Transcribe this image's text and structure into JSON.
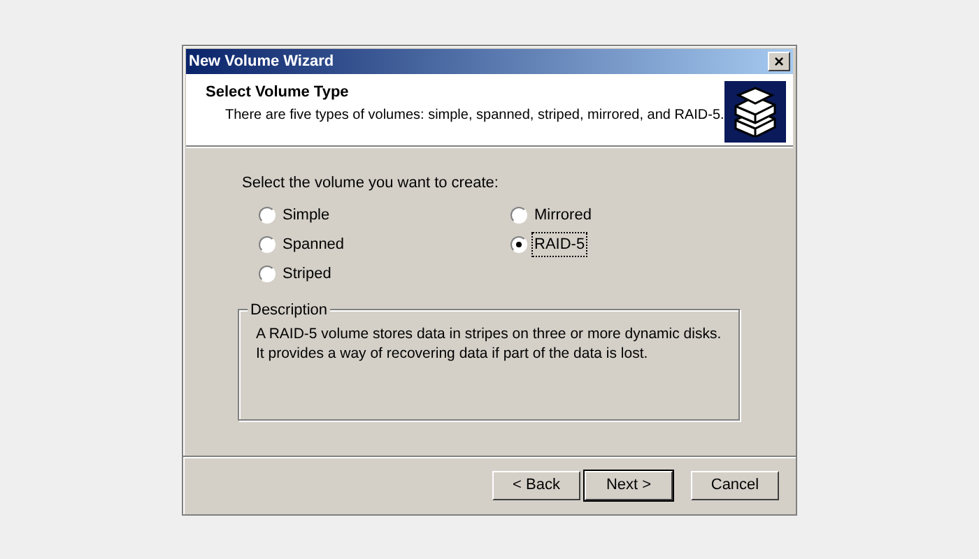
{
  "window": {
    "title": "New Volume Wizard",
    "close": "×"
  },
  "header": {
    "title": "Select Volume Type",
    "subtitle": "There are five types of volumes: simple, spanned, striped, mirrored, and RAID-5."
  },
  "prompt": "Select the volume you want to create:",
  "option_columns": [
    [
      {
        "label": "Simple",
        "selected": false
      },
      {
        "label": "Spanned",
        "selected": false
      },
      {
        "label": "Striped",
        "selected": false
      }
    ],
    [
      {
        "label": "Mirrored",
        "selected": false
      },
      {
        "label": "RAID-5",
        "selected": true
      }
    ]
  ],
  "description": {
    "legend": "Description",
    "text": "A RAID-5 volume stores data in stripes on three or more dynamic disks. It provides a way of recovering data if part of the data is lost."
  },
  "buttons": [
    {
      "label": "< Back",
      "default": false
    },
    {
      "label": "Next >",
      "default": true
    },
    {
      "label": "Cancel",
      "default": false
    }
  ]
}
